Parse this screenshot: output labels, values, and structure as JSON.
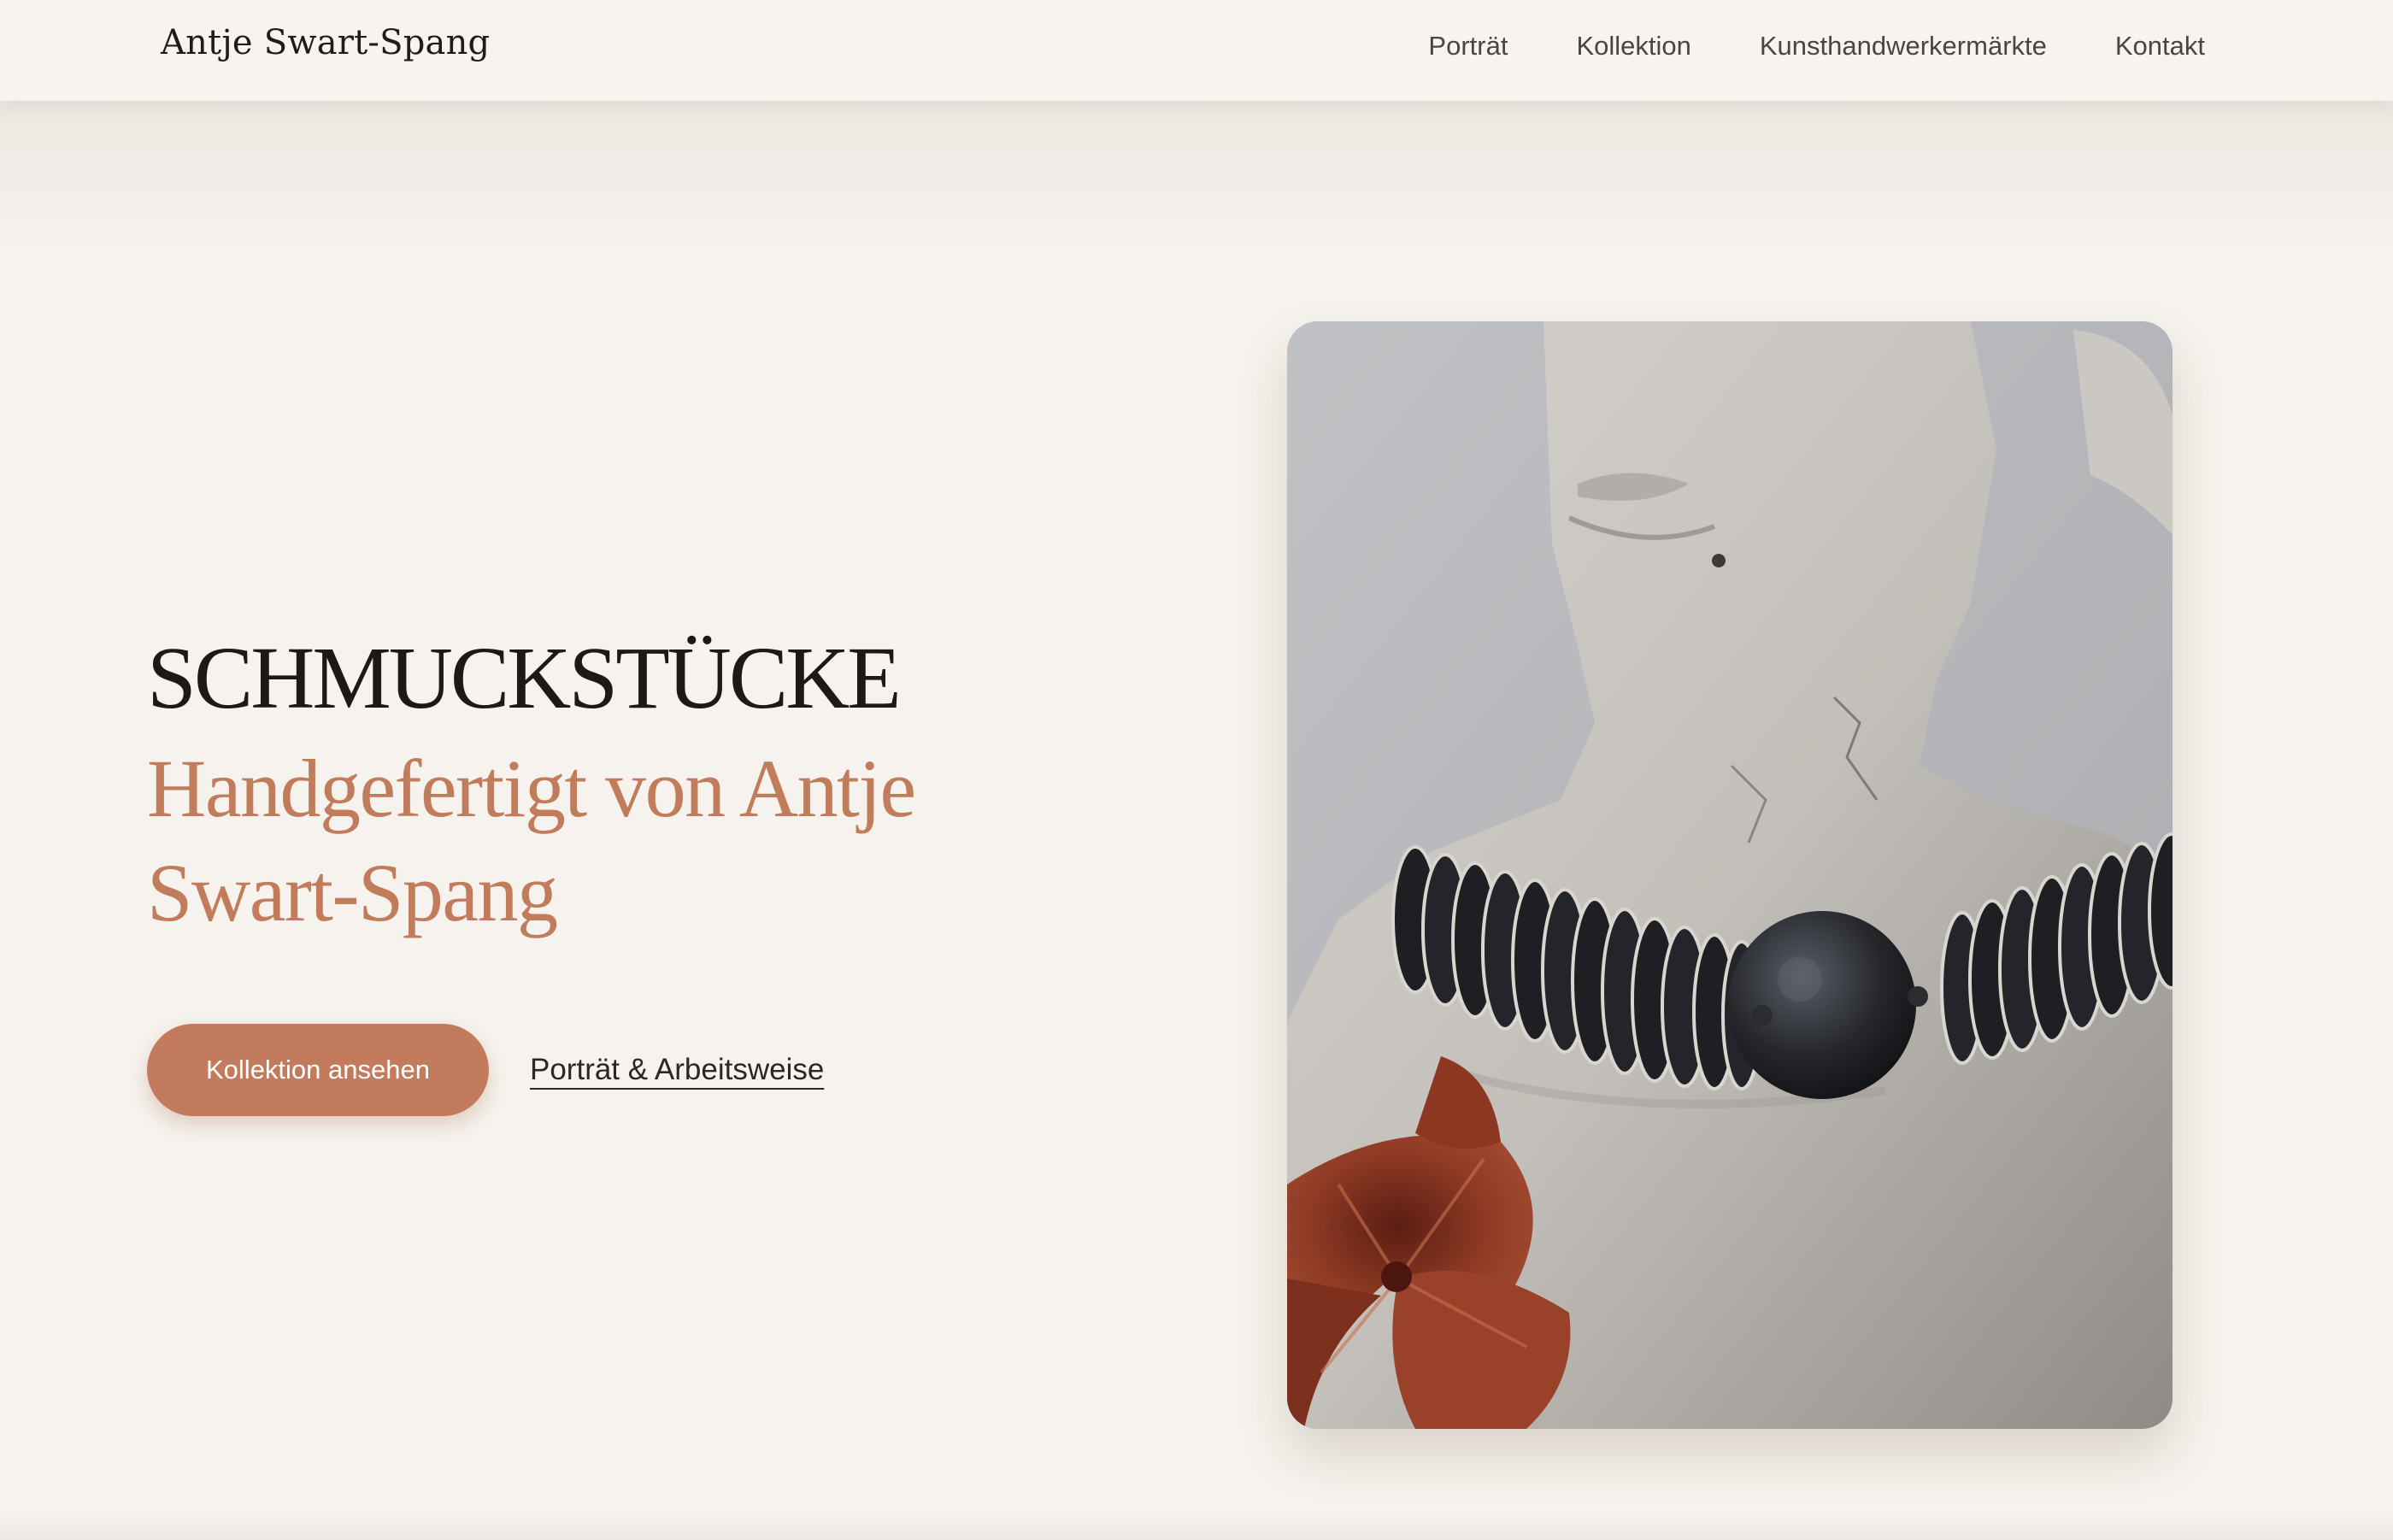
{
  "header": {
    "brand": "Antje Swart-Spang",
    "nav": [
      {
        "label": "Porträt"
      },
      {
        "label": "Kollektion"
      },
      {
        "label": "Kunsthandwerkermärkte"
      },
      {
        "label": "Kontakt"
      }
    ]
  },
  "hero": {
    "title": "SCHMUCKSTÜCKE",
    "subtitle": "Handgefertigt von Antje Swart-Spang",
    "primary_button": "Kollektion ansehen",
    "secondary_link": "Porträt & Arbeitsweise",
    "image_alt": "Betonbüste mit schwarzer Scheibenkette und roter Blüte"
  },
  "colors": {
    "background": "#f6f2ed",
    "accent": "#c27b5c",
    "text": "#1d1917"
  }
}
